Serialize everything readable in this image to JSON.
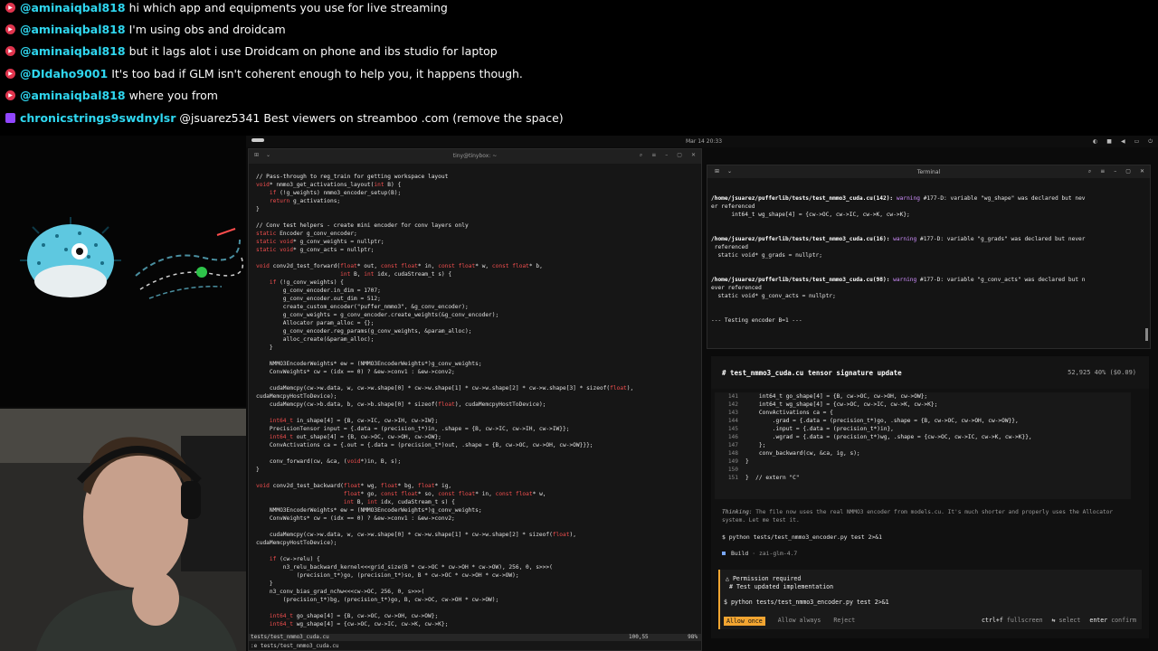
{
  "chat": [
    {
      "platform": "youtube",
      "user": "@aminaiqbal818",
      "message": "hi which app and equipments you use for live streaming"
    },
    {
      "platform": "youtube",
      "user": "@aminaiqbal818",
      "message": "I'm using obs and droidcam"
    },
    {
      "platform": "youtube",
      "user": "@aminaiqbal818",
      "message": "but it lags alot i use Droidcam on phone and ibs studio for laptop"
    },
    {
      "platform": "youtube",
      "user": "@DIdaho9001",
      "message": "It's too bad if GLM isn't coherent enough to help you, it happens though."
    },
    {
      "platform": "youtube",
      "user": "@aminaiqbal818",
      "message": "where you from"
    },
    {
      "platform": "twitch",
      "user": "chronicstrings9swdnylsr",
      "message": "@jsuarez5341 Best viewers on streamboo .com (remove the space)"
    }
  ],
  "topbar": {
    "clock": "Mar 14 20:33"
  },
  "editor": {
    "title": "tiny@tinybox: ~",
    "status_file": "tests/test_nmmo3_cuda.cu",
    "status_pos": "100,55",
    "status_pct": "98%",
    "cmdline": ":e tests/test_nmmo3_cuda.cu",
    "lines": [
      "// Pass-through to reg_train for getting workspace layout",
      "void* nmmo3_get_activations_layout(int B) {",
      "    if (!g_weights) nmmo3_encoder_setup(B);",
      "    return g_activations;",
      "}",
      "",
      "// Conv test helpers - create mini encoder for conv layers only",
      "static Encoder g_conv_encoder;",
      "static void* g_conv_weights = nullptr;",
      "static void* g_conv_acts = nullptr;",
      "",
      "void conv2d_test_forward(float* out, const float* in, const float* w, const float* b,",
      "                         int B, int idx, cudaStream_t s) {",
      "    if (!g_conv_weights) {",
      "        g_conv_encoder.in_dim = 1707;",
      "        g_conv_encoder.out_dim = 512;",
      "        create_custom_encoder(\"puffer_nmmo3\", &g_conv_encoder);",
      "        g_conv_weights = g_conv_encoder.create_weights(&g_conv_encoder);",
      "        Allocator param_alloc = {};",
      "        g_conv_encoder.reg_params(g_conv_weights, &param_alloc);",
      "        alloc_create(&param_alloc);",
      "    }",
      "",
      "    NMMO3EncoderWeights* ew = (NMMO3EncoderWeights*)g_conv_weights;",
      "    ConvWeights* cw = (idx == 0) ? &ew->conv1 : &ew->conv2;",
      "",
      "    cudaMemcpy(cw->w.data, w, cw->w.shape[0] * cw->w.shape[1] * cw->w.shape[2] * cw->w.shape[3] * sizeof(float),",
      "cudaMemcpyHostToDevice);",
      "    cudaMemcpy(cw->b.data, b, cw->b.shape[0] * sizeof(float), cudaMemcpyHostToDevice);",
      "",
      "    int64_t in_shape[4] = {B, cw->IC, cw->IH, cw->IW};",
      "    PrecisionTensor input = {.data = (precision_t*)in, .shape = {B, cw->IC, cw->IH, cw->IW}};",
      "    int64_t out_shape[4] = {B, cw->OC, cw->OH, cw->OW};",
      "    ConvActivations ca = {.out = {.data = (precision_t*)out, .shape = {B, cw->OC, cw->OH, cw->OW}}};",
      "",
      "    conv_forward(cw, &ca, (void*)in, B, s);",
      "}",
      "",
      "void conv2d_test_backward(float* wg, float* bg, float* ig,",
      "                          float* go, const float* so, const float* in, const float* w,",
      "                          int B, int idx, cudaStream_t s) {",
      "    NMMO3EncoderWeights* ew = (NMMO3EncoderWeights*)g_conv_weights;",
      "    ConvWeights* cw = (idx == 0) ? &ew->conv1 : &ew->conv2;",
      "",
      "    cudaMemcpy(cw->w.data, w, cw->w.shape[0] * cw->w.shape[1] * cw->w.shape[2] * sizeof(float),",
      "cudaMemcpyHostToDevice);",
      "",
      "    if (cw->relu) {",
      "        n3_relu_backward_kernel<<<grid_size(B * cw->OC * cw->OH * cw->OW), 256, 0, s>>>(",
      "            (precision_t*)go, (precision_t*)so, B * cw->OC * cw->OH * cw->OW);",
      "    }",
      "    n3_conv_bias_grad_nchw<<<cw->OC, 256, 0, s>>>(",
      "        (precision_t*)bg, (precision_t*)go, B, cw->OC, cw->OH * cw->OW);",
      "",
      "    int64_t go_shape[4] = {B, cw->OC, cw->OH, cw->OW};",
      "    int64_t wg_shape[4] = {cw->OC, cw->IC, cw->K, cw->K};"
    ]
  },
  "terminal": {
    "title": "Terminal",
    "lines": [
      {
        "kind": "warn",
        "path": "/home/jsuarez/pufferlib/tests/test_nmmo3_cuda.cu(142):",
        "label": "warning",
        "text": " #177-D: variable \"wg_shape\" was declared but nev"
      },
      {
        "kind": "plain",
        "text": "er referenced"
      },
      {
        "kind": "plain",
        "text": "      int64_t wg_shape[4] = {cw->OC, cw->IC, cw->K, cw->K};"
      },
      {
        "kind": "plain",
        "text": ""
      },
      {
        "kind": "plain",
        "text": ""
      },
      {
        "kind": "warn",
        "path": "/home/jsuarez/pufferlib/tests/test_nmmo3_cuda.cu(16):",
        "label": "warning",
        "text": " #177-D: variable \"g_grads\" was declared but never"
      },
      {
        "kind": "plain",
        "text": " referenced"
      },
      {
        "kind": "plain",
        "text": "  static void* g_grads = nullptr;"
      },
      {
        "kind": "plain",
        "text": ""
      },
      {
        "kind": "plain",
        "text": ""
      },
      {
        "kind": "warn",
        "path": "/home/jsuarez/pufferlib/tests/test_nmmo3_cuda.cu(98):",
        "label": "warning",
        "text": " #177-D: variable \"g_conv_acts\" was declared but n"
      },
      {
        "kind": "plain",
        "text": "ever referenced"
      },
      {
        "kind": "plain",
        "text": "  static void* g_conv_acts = nullptr;"
      },
      {
        "kind": "plain",
        "text": ""
      },
      {
        "kind": "plain",
        "text": ""
      },
      {
        "kind": "plain",
        "text": "--- Testing encoder B=1 ---"
      }
    ]
  },
  "agent": {
    "title": "# test_nmmo3_cuda.cu tensor signature update",
    "stats": "52,925  40% ($0.09)",
    "diff": [
      {
        "n": "141",
        "code": "    int64_t go_shape[4] = {B, cw->OC, cw->OH, cw->OW};"
      },
      {
        "n": "142",
        "code": "    int64_t wg_shape[4] = {cw->OC, cw->IC, cw->K, cw->K};"
      },
      {
        "n": "143",
        "code": "    ConvActivations ca = {"
      },
      {
        "n": "144",
        "code": "        .grad = {.data = (precision_t*)go, .shape = {B, cw->OC, cw->OH, cw->OW}},"
      },
      {
        "n": "145",
        "code": "        .input = {.data = (precision_t*)in},"
      },
      {
        "n": "146",
        "code": "        .wgrad = {.data = (precision_t*)wg, .shape = {cw->OC, cw->IC, cw->K, cw->K}},"
      },
      {
        "n": "147",
        "code": "    };"
      },
      {
        "n": "148",
        "code": "    conv_backward(cw, &ca, ig, s);"
      },
      {
        "n": "149",
        "code": "}"
      },
      {
        "n": "150",
        "code": ""
      },
      {
        "n": "151",
        "code": "}  // extern \"C\""
      }
    ],
    "thinking_label": "Thinking:",
    "thinking_text": " The file now uses the real NMMO3 encoder from models.cu. It's much shorter and properly uses the Allocator system. Let me test it.",
    "cmd1": "$ python tests/test_nmmo3_encoder.py test 2>&1",
    "build_label": "Build",
    "build_model": "· zai-glm-4.7",
    "perm_title": "△ Permission required",
    "perm_sub": "# Test updated implementation",
    "perm_cmd": "$ python tests/test_nmmo3_encoder.py test 2>&1",
    "allow_once": "Allow once",
    "allow_always": "Allow always",
    "reject": "Reject",
    "hint1_key": "ctrl+f",
    "hint1": "fullscreen",
    "hint2_key": "⇆",
    "hint2": "select",
    "hint3_key": "enter",
    "hint3": "confirm"
  }
}
